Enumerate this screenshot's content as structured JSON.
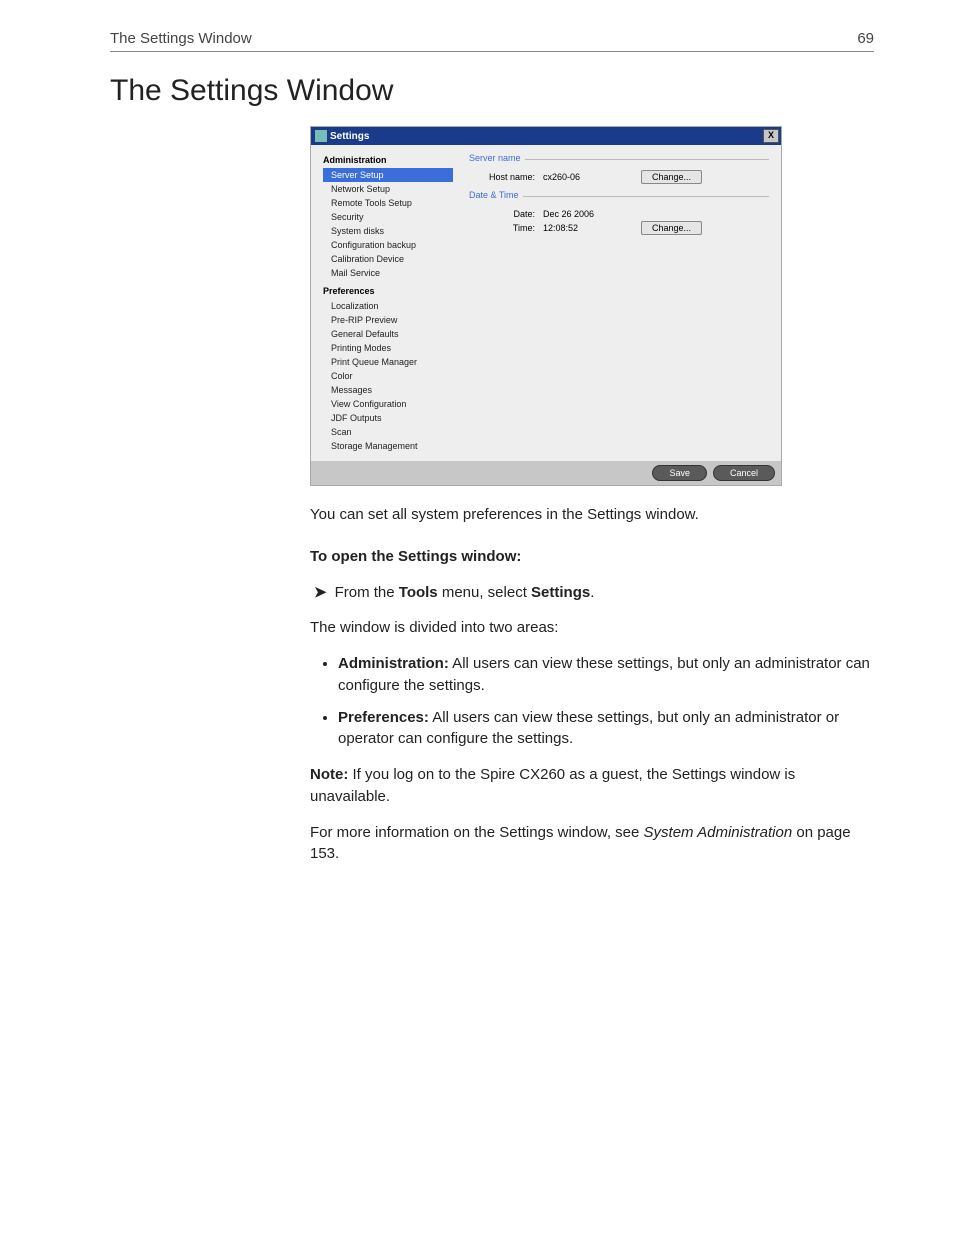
{
  "header": {
    "running_left": "The Settings Window",
    "page_number": "69"
  },
  "heading": "The Settings Window",
  "screenshot": {
    "title": "Settings",
    "close": "X",
    "sidebar": {
      "group1": "Administration",
      "items1": [
        "Server Setup",
        "Network Setup",
        "Remote Tools Setup",
        "Security",
        "System disks",
        "Configuration backup",
        "Calibration Device",
        "Mail Service"
      ],
      "group2": "Preferences",
      "items2": [
        "Localization",
        "Pre-RIP Preview",
        "General Defaults",
        "Printing Modes",
        "Print Queue Manager",
        "Color",
        "Messages",
        "View Configuration",
        "JDF Outputs",
        "Scan",
        "Storage Management"
      ]
    },
    "panel": {
      "section1": "Server name",
      "host_label": "Host name:",
      "host_value": "cx260-06",
      "change1": "Change...",
      "section2": "Date & Time",
      "date_label": "Date:",
      "date_value": "Dec 26 2006",
      "time_label": "Time:",
      "time_value": "12:08:52",
      "change2": "Change..."
    },
    "footer": {
      "save": "Save",
      "cancel": "Cancel"
    }
  },
  "body": {
    "intro": "You can set all system preferences in the Settings window.",
    "open_header": "To open the Settings window:",
    "step_pre": "From the ",
    "step_tools": "Tools",
    "step_mid": " menu, select ",
    "step_settings": "Settings",
    "step_post": ".",
    "divided": "The window is divided into two areas:",
    "bullet1_label": "Administration:",
    "bullet1_text": " All users can view these settings, but only an administrator can configure the settings.",
    "bullet2_label": "Preferences:",
    "bullet2_text": " All users can view these settings, but only an administrator or operator can configure the settings.",
    "note_label": "Note:",
    "note_text": "  If you log on to the Spire CX260 as a guest, the Settings window is unavailable.",
    "ref_pre": "For more information on the Settings window, see ",
    "ref_link": "System Administration",
    "ref_post": " on page 153."
  }
}
